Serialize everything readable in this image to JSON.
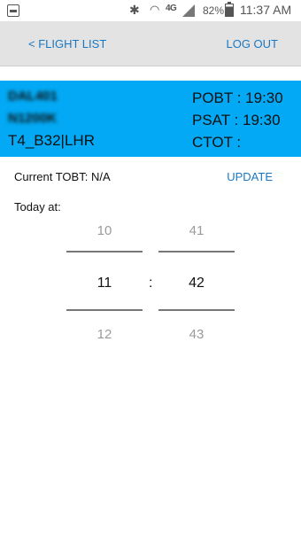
{
  "statusbar": {
    "network": "4G",
    "battery": "82%",
    "time": "11:37 AM"
  },
  "nav": {
    "back_label": "< FLIGHT LIST",
    "logout_label": "LOG OUT"
  },
  "flight": {
    "callsign": "DAL401",
    "registration": "N1200K",
    "stand_airport": "T4_B32|LHR",
    "pobt": "POBT : 19:30",
    "psat": "PSAT : 19:30",
    "ctot": "CTOT :"
  },
  "tobt": {
    "label": "Current TOBT:",
    "value": "N/A",
    "update_label": "UPDATE"
  },
  "picker": {
    "today_label": "Today at:",
    "hours": {
      "prev": "10",
      "selected": "11",
      "next": "12"
    },
    "separator": ":",
    "minutes": {
      "prev": "41",
      "selected": "42",
      "next": "43"
    }
  },
  "colors": {
    "accent": "#03a9f4",
    "link": "#1a78c2",
    "nav_bg": "#e3e3e3"
  }
}
